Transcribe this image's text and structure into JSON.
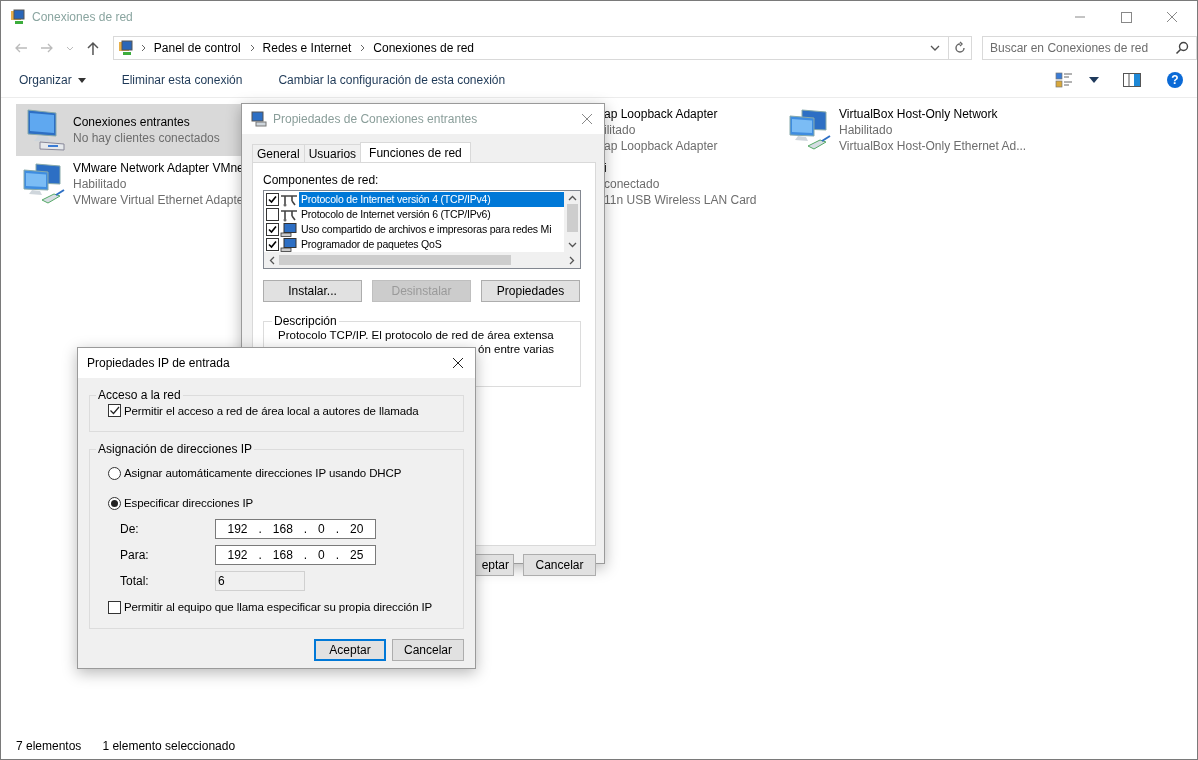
{
  "window": {
    "title": "Conexiones de red"
  },
  "address": {
    "breadcrumbs": [
      "Panel de control",
      "Redes e Internet",
      "Conexiones de red"
    ]
  },
  "search": {
    "placeholder": "Buscar en Conexiones de red"
  },
  "commands": [
    {
      "label": "Organizar",
      "kind": "menu"
    },
    {
      "label": "Eliminar esta conexión",
      "kind": "action"
    },
    {
      "label": "Cambiar la configuración de esta conexión",
      "kind": "action"
    }
  ],
  "help_glyph": "?",
  "connection_columns": [
    {
      "items": [
        {
          "name": "Conexiones entrantes",
          "status": "No hay clientes conectados",
          "kind": "incoming",
          "selected": true
        },
        {
          "name": "VMware Network Adapter VMne",
          "status": "Habilitado",
          "device": "VMware Virtual Ethernet Adapte",
          "kind": "adapter",
          "selected": false
        }
      ]
    },
    {
      "items": [
        {
          "name": "ap Loopback Adapter",
          "status": "ilitado",
          "device": "ap Loopback Adapter",
          "kind": "covered",
          "selected": false
        },
        {
          "name": "i",
          "status": "conectado",
          "device": "11n USB Wireless LAN Card",
          "kind": "covered",
          "selected": false
        }
      ]
    },
    {
      "items": [
        {
          "name": "VirtualBox Host-Only Network",
          "status": "Habilitado",
          "device": "VirtualBox Host-Only Ethernet Ad...",
          "kind": "adapter",
          "selected": false
        }
      ]
    }
  ],
  "dialog1": {
    "title": "Propiedades de Conexiones entrantes",
    "tabs": [
      {
        "label": "General",
        "selected": false
      },
      {
        "label": "Usuarios",
        "selected": false
      },
      {
        "label": "Funciones de red",
        "selected": true
      }
    ],
    "components_label": "Componentes de red:",
    "components": [
      {
        "label": "Protocolo de Internet versión 4 (TCP/IPv4)",
        "checked": true,
        "selected": true,
        "kind": "protocol"
      },
      {
        "label": "Protocolo de Internet versión 6 (TCP/IPv6)",
        "checked": false,
        "selected": false,
        "kind": "protocol"
      },
      {
        "label": "Uso compartido de archivos e impresoras para redes Mi",
        "checked": true,
        "selected": false,
        "kind": "computer"
      },
      {
        "label": "Programador de paquetes QoS",
        "checked": true,
        "selected": false,
        "kind": "computer"
      }
    ],
    "buttons": [
      {
        "label": "Instalar...",
        "disabled": false
      },
      {
        "label": "Desinstalar",
        "disabled": true
      },
      {
        "label": "Propiedades",
        "disabled": false
      }
    ],
    "description": {
      "legend": "Descripción",
      "lines": [
        {
          "text": "Protocolo TCP/IP. El protocolo de red de área extensa",
          "kind": "full"
        },
        {
          "text": "ón entre varias",
          "kind": "covered"
        }
      ]
    },
    "footer_buttons": [
      {
        "label": "eptar",
        "kind": "covered"
      },
      {
        "label": "Cancelar",
        "kind": "full"
      }
    ]
  },
  "dialog2": {
    "title": "Propiedades IP de entrada",
    "access": {
      "legend": "Acceso a la red",
      "checkbox": {
        "label": "Permitir el acceso a red de área local a autores de llamada",
        "checked": true
      }
    },
    "assignment": {
      "legend": "Asignación de direcciones IP",
      "options": [
        {
          "label": "Asignar automáticamente direcciones IP usando DHCP",
          "selected": false
        },
        {
          "label": "Especificar direcciones IP",
          "selected": true
        }
      ],
      "fields": [
        {
          "label": "De:",
          "kind": "ip",
          "octets": [
            "192",
            "168",
            "0",
            "20"
          ],
          "separator": "."
        },
        {
          "label": "Para:",
          "kind": "ip",
          "octets": [
            "192",
            "168",
            "0",
            "25"
          ],
          "separator": "."
        },
        {
          "label": "Total:",
          "kind": "readonly",
          "value": "6"
        }
      ],
      "checkbox": {
        "label": "Permitir al equipo que llama especificar su propia dirección IP",
        "checked": false
      }
    },
    "buttons": [
      {
        "label": "Aceptar",
        "default": true
      },
      {
        "label": "Cancelar",
        "default": false
      }
    ]
  },
  "status_bar": {
    "items": [
      "7 elementos",
      "1 elemento seleccionado"
    ]
  }
}
